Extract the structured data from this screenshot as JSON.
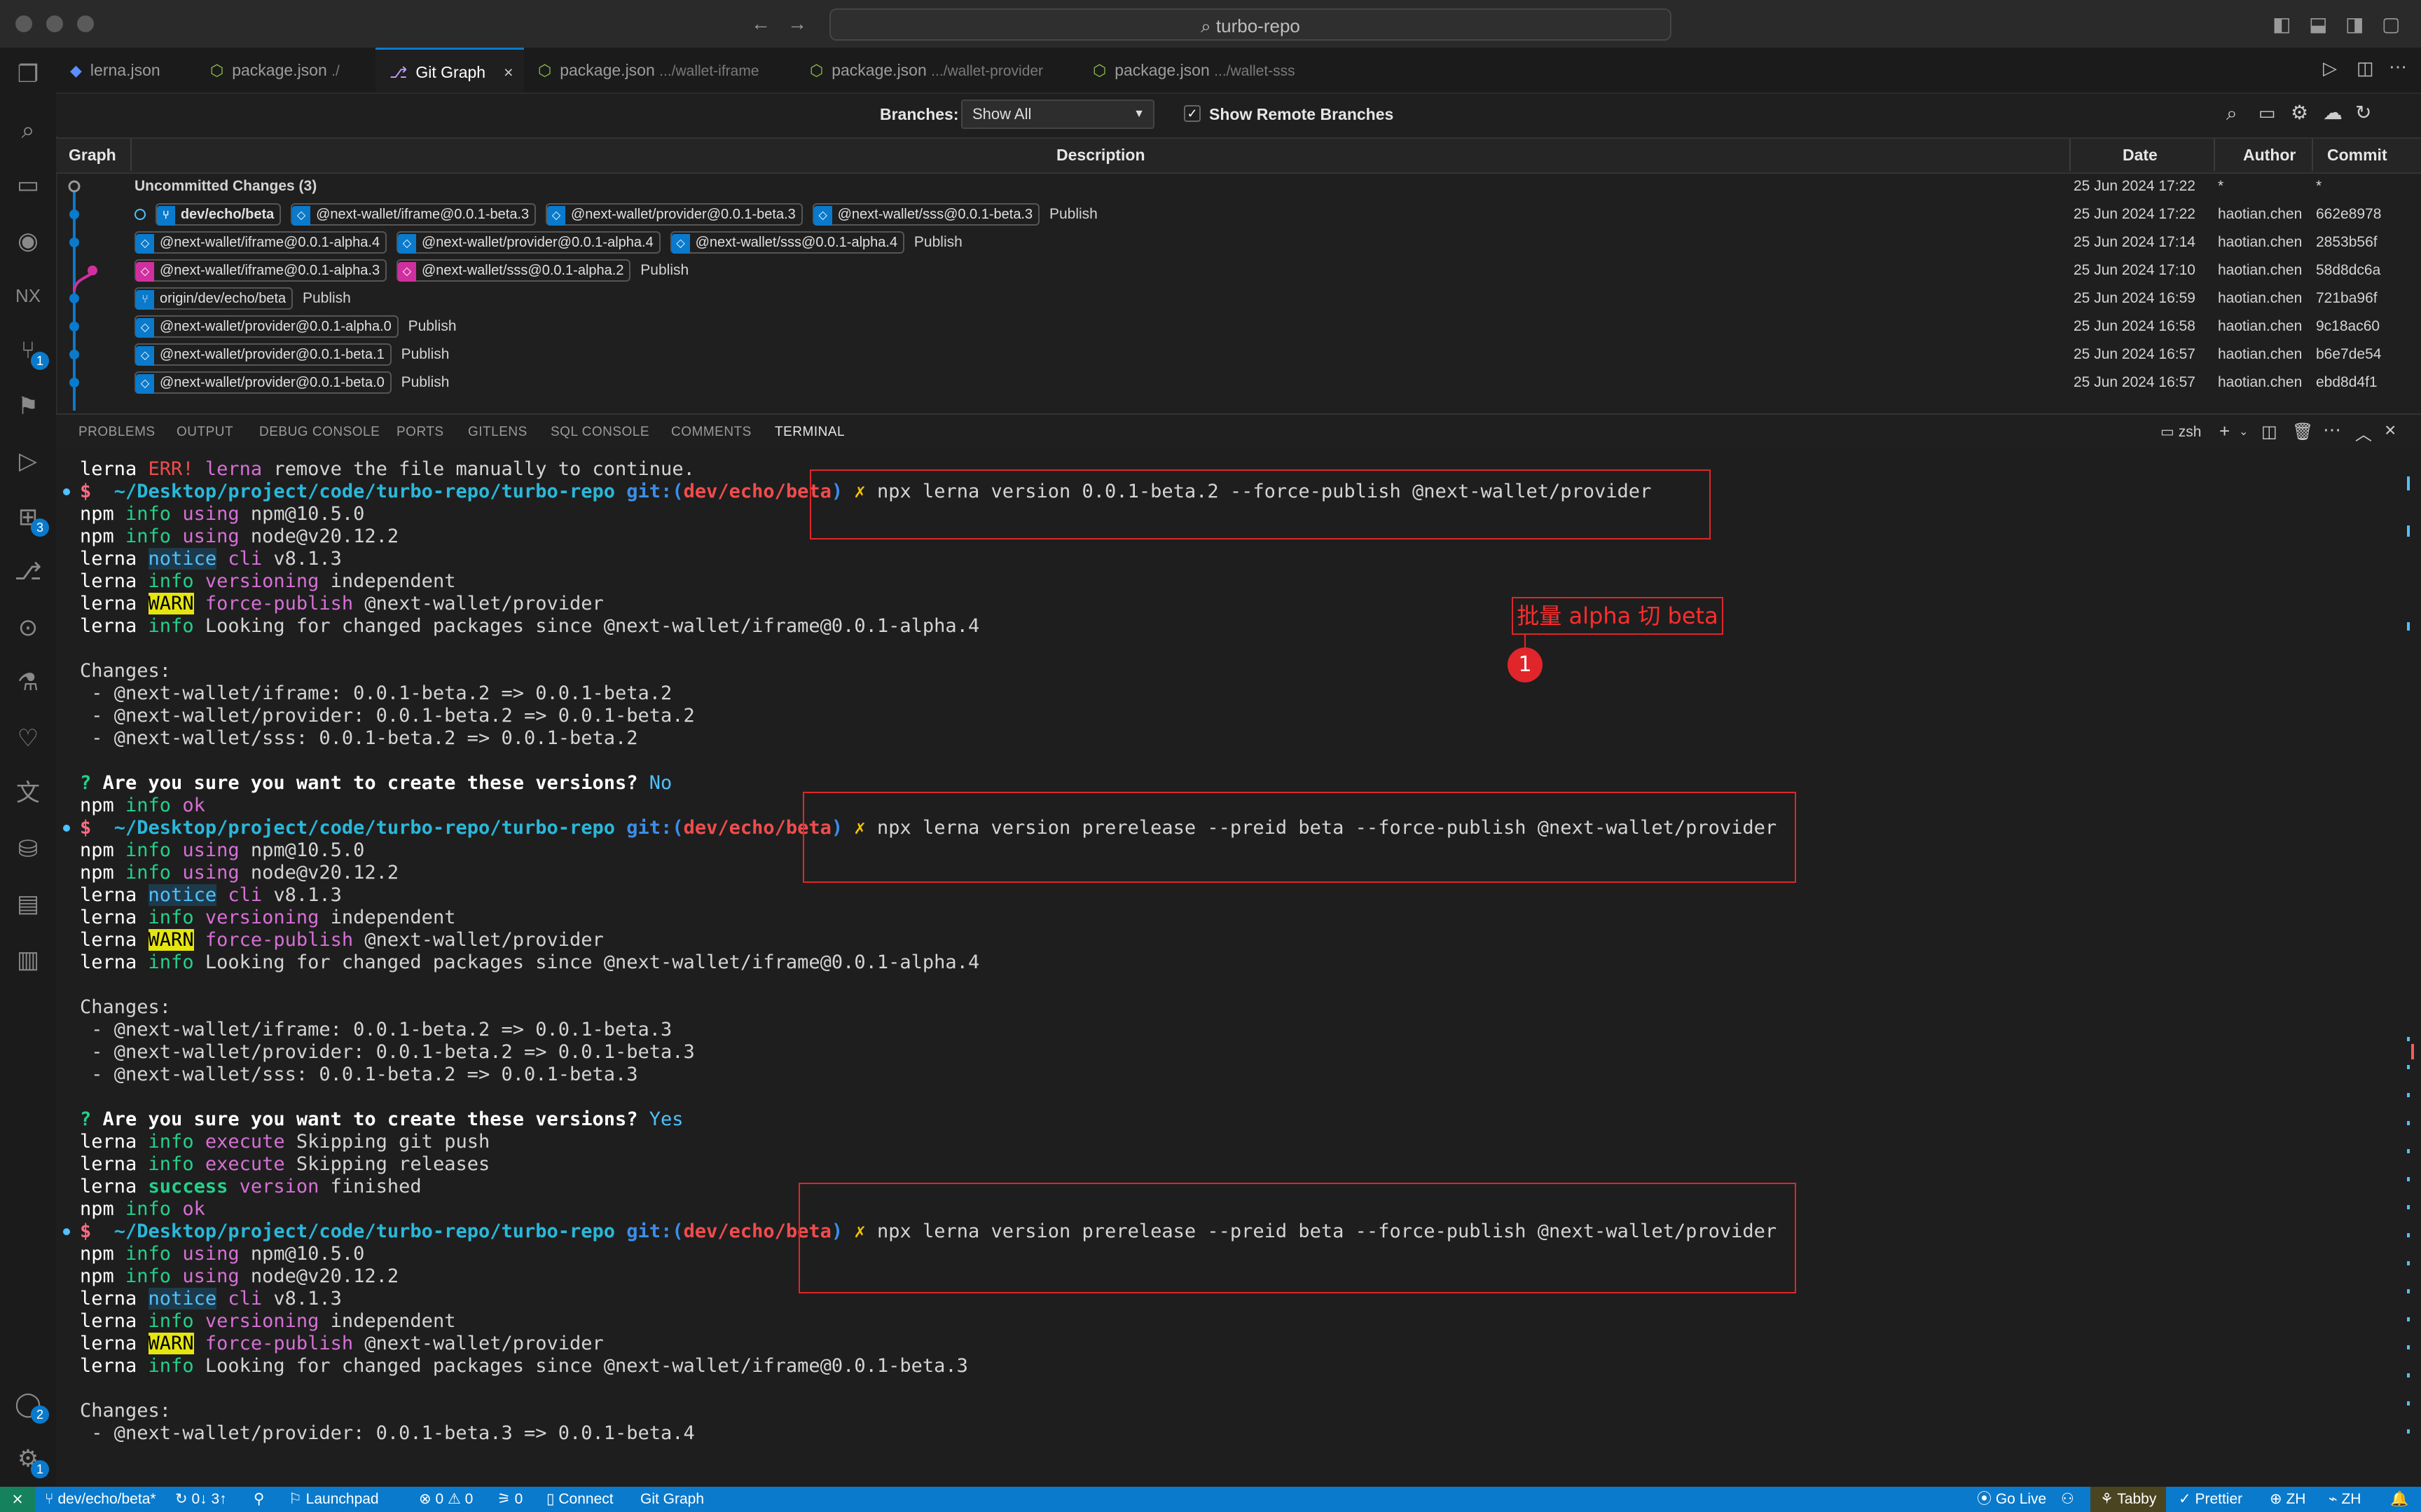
{
  "titlebar": {
    "search": "turbo-repo"
  },
  "activity": {
    "scm_badge": "1",
    "ext_badge": "3",
    "account_badge": "2",
    "settings_badge": "1"
  },
  "tabs": [
    {
      "label": "lerna.json",
      "desc": ""
    },
    {
      "label": "package.json",
      "desc": "./"
    },
    {
      "label": "Git Graph",
      "desc": ""
    },
    {
      "label": "package.json",
      "desc": ".../wallet-iframe"
    },
    {
      "label": "package.json",
      "desc": ".../wallet-provider"
    },
    {
      "label": "package.json",
      "desc": ".../wallet-sss"
    }
  ],
  "gitgraph": {
    "branches_label": "Branches:",
    "branches_value": "Show All",
    "remote_label": "Show Remote Branches",
    "columns": {
      "graph": "Graph",
      "description": "Description",
      "date": "Date",
      "author": "Author",
      "commit": "Commit"
    },
    "uncommitted": {
      "text": "Uncommitted Changes (3)",
      "date": "25 Jun 2024 17:22",
      "author": "*",
      "commit": "*"
    },
    "rows": [
      {
        "refs": [
          "dev/echo/beta",
          "@next-wallet/iframe@0.0.1-beta.3",
          "@next-wallet/provider@0.0.1-beta.3",
          "@next-wallet/sss@0.0.1-beta.3"
        ],
        "msg": "Publish",
        "date": "25 Jun 2024 17:22",
        "author": "haotian.chen",
        "commit": "662e8978"
      },
      {
        "refs": [
          "@next-wallet/iframe@0.0.1-alpha.4",
          "@next-wallet/provider@0.0.1-alpha.4",
          "@next-wallet/sss@0.0.1-alpha.4"
        ],
        "msg": "Publish",
        "date": "25 Jun 2024 17:14",
        "author": "haotian.chen",
        "commit": "2853b56f"
      },
      {
        "refs": [
          "@next-wallet/iframe@0.0.1-alpha.3",
          "@next-wallet/sss@0.0.1-alpha.2"
        ],
        "msg": "Publish",
        "date": "25 Jun 2024 17:10",
        "author": "haotian.chen",
        "commit": "58d8dc6a"
      },
      {
        "refs": [
          "origin/dev/echo/beta"
        ],
        "msg": "Publish",
        "date": "25 Jun 2024 16:59",
        "author": "haotian.chen",
        "commit": "721ba96f"
      },
      {
        "refs": [
          "@next-wallet/provider@0.0.1-alpha.0"
        ],
        "msg": "Publish",
        "date": "25 Jun 2024 16:58",
        "author": "haotian.chen",
        "commit": "9c18ac60"
      },
      {
        "refs": [
          "@next-wallet/provider@0.0.1-beta.1"
        ],
        "msg": "Publish",
        "date": "25 Jun 2024 16:57",
        "author": "haotian.chen",
        "commit": "b6e7de54"
      },
      {
        "refs": [
          "@next-wallet/provider@0.0.1-beta.0"
        ],
        "msg": "Publish",
        "date": "25 Jun 2024 16:57",
        "author": "haotian.chen",
        "commit": "ebd8d4f1"
      }
    ]
  },
  "panel_tabs": [
    "PROBLEMS",
    "OUTPUT",
    "DEBUG CONSOLE",
    "PORTS",
    "GITLENS",
    "SQL CONSOLE",
    "COMMENTS",
    "TERMINAL"
  ],
  "terminal": {
    "shell": "zsh",
    "prompt_path": "~/Desktop/project/code/turbo-repo/turbo-repo",
    "prompt_git": "git:(",
    "prompt_branch": "dev/echo/beta",
    "prompt_close": ")",
    "cmd1": "npx lerna version 0.0.1-beta.2 --force-publish @next-wallet/provider",
    "cmd2": "npx lerna version prerelease --preid beta --force-publish @next-wallet/provider",
    "cmd3": "npx lerna version prerelease --preid beta --force-publish @next-wallet/provider",
    "err_line": "remove the file manually to continue.",
    "npm_ver": "npm@10.5.0",
    "node_ver": "node@v20.12.2",
    "cli_ver": "v8.1.3",
    "versioning": "independent",
    "force": "@next-wallet/provider",
    "since_alpha": "Looking for changed packages since @next-wallet/iframe@0.0.1-alpha.4",
    "since_beta": "Looking for changed packages since @next-wallet/iframe@0.0.1-beta.3",
    "changes_label": "Changes:",
    "changes1": [
      " - @next-wallet/iframe: 0.0.1-beta.2 => 0.0.1-beta.2",
      " - @next-wallet/provider: 0.0.1-beta.2 => 0.0.1-beta.2",
      " - @next-wallet/sss: 0.0.1-beta.2 => 0.0.1-beta.2"
    ],
    "changes2": [
      " - @next-wallet/iframe: 0.0.1-beta.2 => 0.0.1-beta.3",
      " - @next-wallet/provider: 0.0.1-beta.2 => 0.0.1-beta.3",
      " - @next-wallet/sss: 0.0.1-beta.2 => 0.0.1-beta.3"
    ],
    "changes3": [
      " - @next-wallet/provider: 0.0.1-beta.3 => 0.0.1-beta.4"
    ],
    "question": "Are you sure you want to create these versions?",
    "answer_no": "No",
    "answer_yes": "Yes",
    "skip_push": "Skipping git push",
    "skip_rel": "Skipping releases",
    "finished": "finished",
    "annotation": "批量 alpha 切 beta",
    "annotation_num": "1"
  },
  "statusbar": {
    "branch": "dev/echo/beta*",
    "sync": "0↓ 3↑",
    "launchpad": "Launchpad",
    "problems": "0 ⚠ 0",
    "ports": "0",
    "connect": "Connect",
    "gitgraph": "Git Graph",
    "golive": "Go Live",
    "tabby": "Tabby",
    "prettier": "Prettier",
    "lang": "ZH",
    "input": "ZH"
  }
}
